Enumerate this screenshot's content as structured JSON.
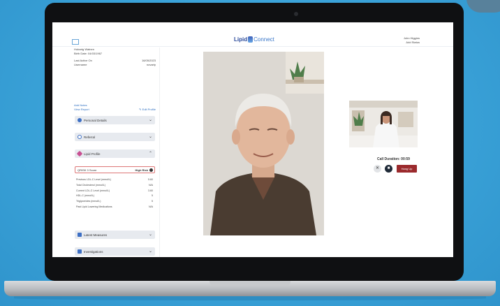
{
  "header": {
    "logo_part1": "Lipid",
    "logo_part2": "Connect",
    "user_name": "John Higgins",
    "status_link": "Add Status"
  },
  "patient": {
    "name": "Hobartg Watnen",
    "dob_label": "Birth Date: 04/03/1967",
    "last_active_label": "Last Active On",
    "last_active_value": "16/05/2023",
    "username_label": "Username",
    "username_value": "novarty"
  },
  "links": {
    "add_notes": "Add Notes",
    "view_report": "View Report",
    "edit_profile": "Edit Profile"
  },
  "accordions": {
    "personal": "Personal Details",
    "referral": "Referral",
    "lipid": "Lipid Profile",
    "latest": "Latest Measures",
    "investigations": "Investigations"
  },
  "risk": {
    "label": "QRISK 3 Score",
    "value": "High Risk"
  },
  "lipid_rows": [
    {
      "label": "Previous LDL-C Level (mmol/L)",
      "value": "5.60"
    },
    {
      "label": "Total Cholesterol (mmol/L)",
      "value": "N/A"
    },
    {
      "label": "Current LDL-C Level (mmol/L)",
      "value": "3.60"
    },
    {
      "label": "HDL-C (mmol/L)",
      "value": "5"
    },
    {
      "label": "Triglycerides (mmol/L)",
      "value": "5"
    },
    {
      "label": "Past Lipid Lowering Medications",
      "value": "N/A"
    }
  ],
  "call": {
    "duration_label": "Call Duration: 00:59",
    "hang_up": "Hang Up"
  },
  "colors": {
    "brand": "#2a4a9b",
    "hang_up": "#9b2a2d",
    "risk_border": "#d77777"
  }
}
